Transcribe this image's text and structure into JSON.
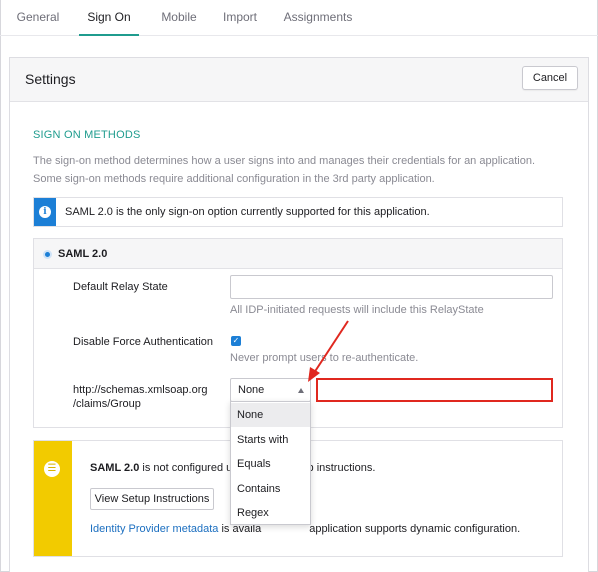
{
  "tabs": [
    {
      "label": "General"
    },
    {
      "label": "Sign On"
    },
    {
      "label": "Mobile"
    },
    {
      "label": "Import"
    },
    {
      "label": "Assignments"
    }
  ],
  "active_tab": "Sign On",
  "settings": {
    "title": "Settings",
    "cancel_label": "Cancel"
  },
  "sign_on_methods": {
    "heading": "SIGN ON METHODS",
    "description": "The sign-on method determines how a user signs into and manages their credentials for an application. Some sign-on methods require additional configuration in the 3rd party application."
  },
  "info_banner": {
    "icon": "info-icon",
    "text": "SAML 2.0 is the only sign-on option currently supported for this application."
  },
  "saml": {
    "title": "SAML 2.0",
    "selected": true,
    "relay_state": {
      "label": "Default Relay State",
      "value": "",
      "helper": "All IDP-initiated requests will include this RelayState"
    },
    "force_auth": {
      "label": "Disable Force Authentication",
      "checked": true,
      "helper": "Never prompt users to re-authenticate."
    },
    "group": {
      "label_line1": "http://schemas.xmlsoap.org",
      "label_line2": "/claims/Group",
      "selected": "None",
      "options": [
        "None",
        "Starts with",
        "Equals",
        "Contains",
        "Regex"
      ],
      "value": ""
    }
  },
  "notice": {
    "icon": "list-icon",
    "bold": "SAML 2.0",
    "text_left": " is not configured unt",
    "text_right": "he setup instructions.",
    "button_label": "View Setup Instructions",
    "link_text": "Identity Provider metadata",
    "footer_left": " is availa",
    "footer_right": "application supports dynamic configuration."
  },
  "colors": {
    "accent_teal": "#1f9c8e",
    "info_blue": "#1c7fd6",
    "warning_yellow": "#f2cb00",
    "highlight_red": "#e0281f"
  }
}
